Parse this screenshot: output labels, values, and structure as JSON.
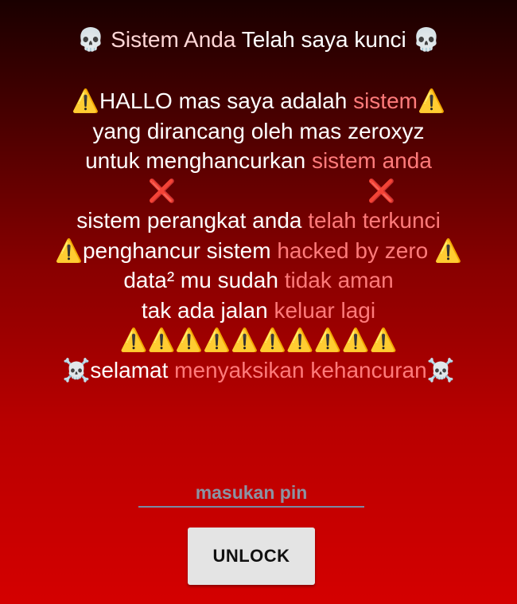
{
  "title": {
    "skull_left": "💀",
    "part_pink": "Sistem Anda",
    "part_white": "Telah saya kunci",
    "skull_right": "💀"
  },
  "message": {
    "line1": {
      "warn_left": "⚠️",
      "white": "HALLO mas saya adalah",
      "pink": "sistem",
      "warn_right": "⚠️"
    },
    "line2": {
      "white": "yang dirancang oleh mas zeroxyz"
    },
    "line3": {
      "white": "untuk menghancurkan",
      "pink": "sistem anda"
    },
    "line4": {
      "cross_left": "❌",
      "cross_right": "❌"
    },
    "line5": {
      "white": "sistem perangkat anda",
      "pink": "telah terkunci"
    },
    "line6": {
      "warn_left": "⚠️",
      "white": "penghancur sistem",
      "pink": "hacked by zero",
      "warn_right": "⚠️"
    },
    "line7": {
      "white": "data² mu sudah",
      "pink": "tidak aman"
    },
    "line8": {
      "white": "tak ada jalan",
      "pink": "keluar lagi"
    },
    "line9": {
      "warnings": "⚠️⚠️⚠️⚠️⚠️⚠️⚠️⚠️⚠️⚠️"
    },
    "line10": {
      "skull_left": "☠️",
      "white": "selamat",
      "pink": "menyaksikan kehancuran",
      "skull_right": "☠️"
    }
  },
  "pin": {
    "placeholder": "masukan pin",
    "value": ""
  },
  "unlock_button": {
    "label": "UNLOCK"
  },
  "colors": {
    "background_top": "#1a0000",
    "background_bottom": "#d40000",
    "pink_text": "#ff7b7b",
    "warning": "#ffcc00",
    "button_bg": "#e4e4e4"
  }
}
